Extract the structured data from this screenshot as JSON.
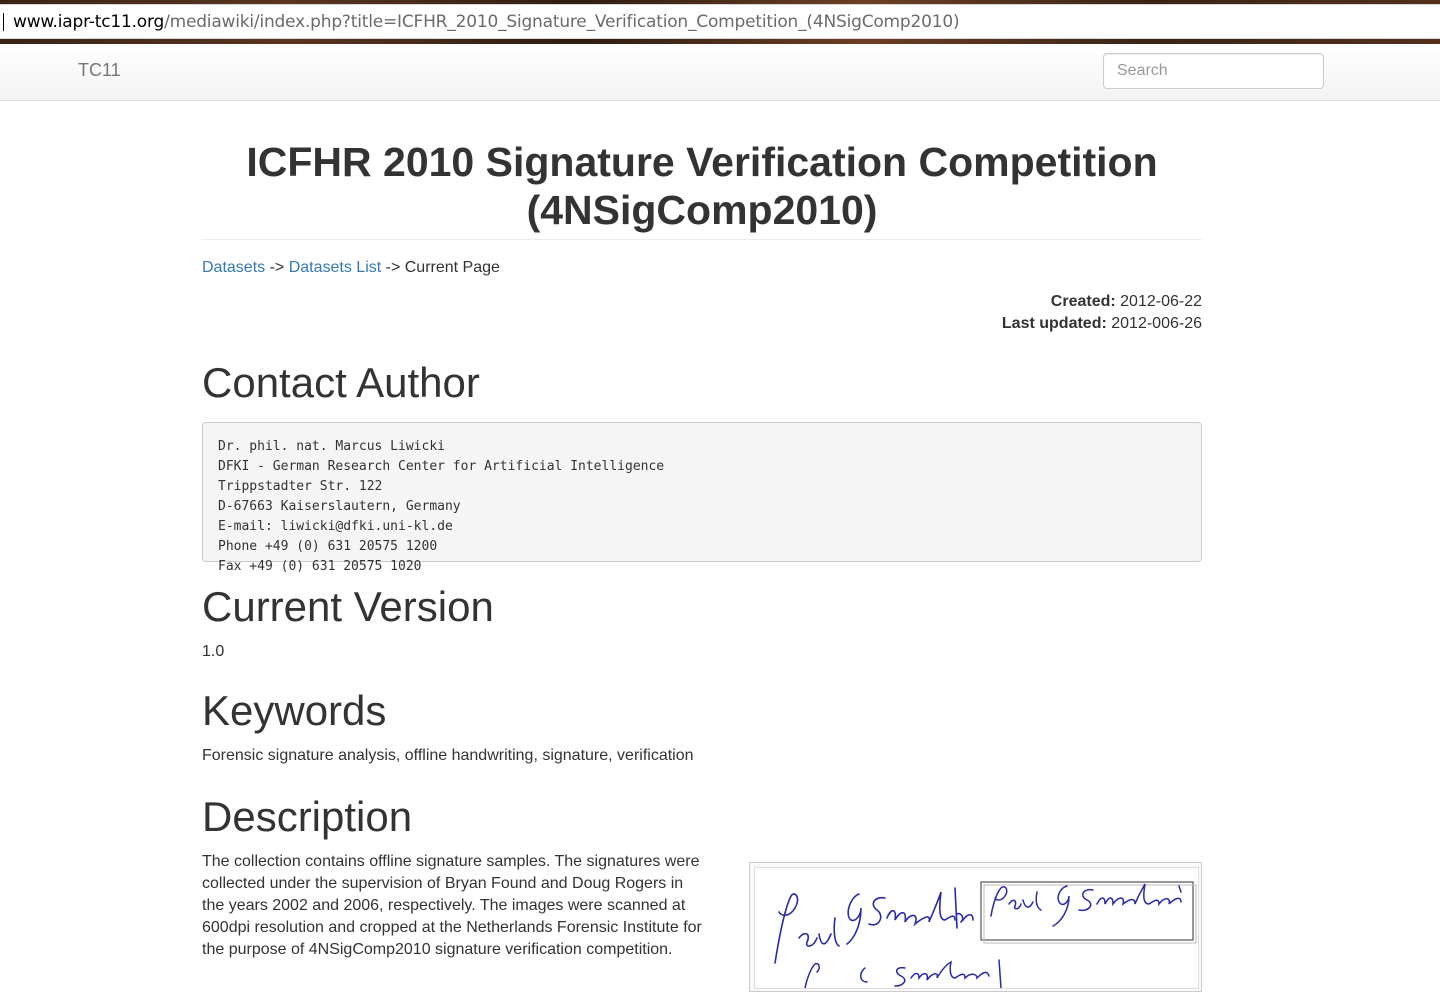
{
  "browser": {
    "url_host": "www.iapr-tc11.org",
    "url_path": "/mediawiki/index.php?title=ICFHR_2010_Signature_Verification_Competition_(4NSigComp2010)"
  },
  "navbar": {
    "brand": "TC11",
    "search_placeholder": "Search"
  },
  "page": {
    "title": "ICFHR 2010 Signature Verification Competition (4NSigComp2010)",
    "breadcrumb": {
      "item1": "Datasets",
      "sep1": " -> ",
      "item2": "Datasets List",
      "sep2": " -> ",
      "current": "Current Page"
    },
    "meta": {
      "created_label": "Created:",
      "created_value": "2012-06-22",
      "updated_label": "Last updated:",
      "updated_value": "2012-006-26"
    },
    "contact": {
      "heading": "Contact Author",
      "text": "Dr. phil. nat. Marcus Liwicki\nDFKI - German Research Center for Artificial Intelligence\nTrippstadter Str. 122\nD-67663 Kaiserslautern, Germany\nE-mail: liwicki@dfki.uni-kl.de\nPhone +49 (0) 631 20575 1200\nFax +49 (0) 631 20575 1020"
    },
    "version": {
      "heading": "Current Version",
      "value": "1.0"
    },
    "keywords": {
      "heading": "Keywords",
      "value": "Forensic signature analysis, offline handwriting, signature, verification"
    },
    "description": {
      "heading": "Description",
      "text": "The collection contains offline signature samples. The signatures were collected under the supervision of Bryan Found and Doug Rogers in the years 2002 and 2006, respectively. The images were scanned at 600dpi resolution and cropped at the Netherlands Forensic Institute for the purpose of 4NSigComp2010 signature verification competition.",
      "figure_signature": "Paul G Smolenski"
    }
  },
  "colors": {
    "link": "#337ab7",
    "text": "#333333",
    "signature_ink": "#2a2aa8"
  }
}
